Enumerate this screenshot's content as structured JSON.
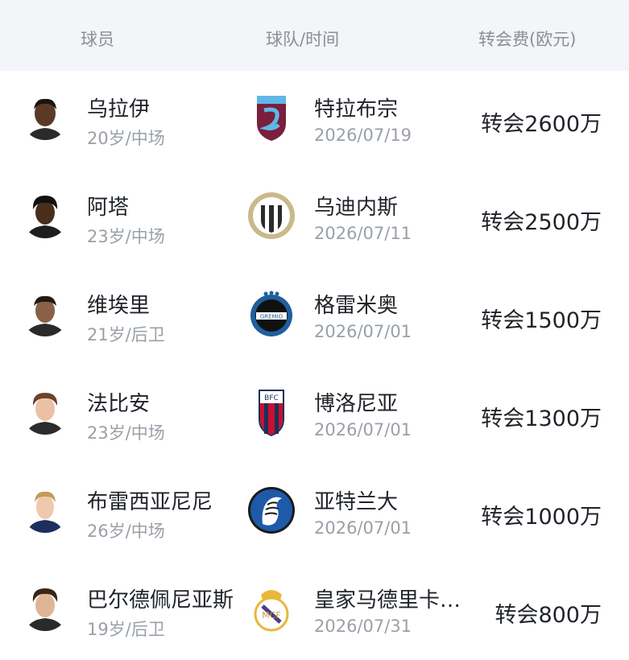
{
  "header": {
    "player": "球员",
    "team_time": "球队/时间",
    "fee": "转会费(欧元)"
  },
  "rows": [
    {
      "name": "乌拉伊",
      "sub": "20岁/中场",
      "team": "特拉布宗",
      "date": "2026/07/19",
      "fee": "转会2600万",
      "team_logo": "trabzonspor-logo"
    },
    {
      "name": "阿塔",
      "sub": "23岁/中场",
      "team": "乌迪内斯",
      "date": "2026/07/11",
      "fee": "转会2500万",
      "team_logo": "udinese-logo"
    },
    {
      "name": "维埃里",
      "sub": "21岁/后卫",
      "team": "格雷米奥",
      "date": "2026/07/01",
      "fee": "转会1500万",
      "team_logo": "gremio-logo"
    },
    {
      "name": "法比安",
      "sub": "23岁/中场",
      "team": "博洛尼亚",
      "date": "2026/07/01",
      "fee": "转会1300万",
      "team_logo": "bologna-logo"
    },
    {
      "name": "布雷西亚尼尼",
      "sub": "26岁/中场",
      "team": "亚特兰大",
      "date": "2026/07/01",
      "fee": "转会1000万",
      "team_logo": "atalanta-logo"
    },
    {
      "name": "巴尔德佩尼亚斯",
      "sub": "19岁/后卫",
      "team": "皇家马德里卡…",
      "date": "2026/07/31",
      "fee": "转会800万",
      "team_logo": "real-madrid-logo"
    }
  ],
  "colors": {
    "header_bg": "#f3f5f9",
    "header_text": "#8a8f99",
    "primary_text": "#1f2329",
    "secondary_text": "#9aa0a8"
  }
}
